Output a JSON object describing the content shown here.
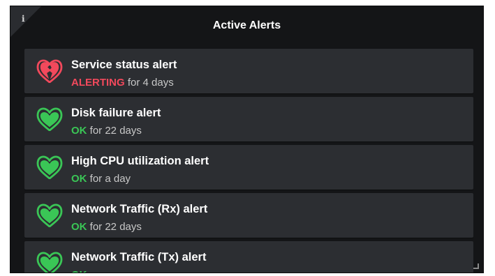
{
  "panel": {
    "title": "Active Alerts",
    "info_icon": "i"
  },
  "colors": {
    "alerting": "#f2495c",
    "ok": "#3ac656",
    "panel_bg": "#141517",
    "row_bg": "#2c2e32"
  },
  "alerts": [
    {
      "name": "Service status alert",
      "state": "ALERTING",
      "duration": "for 4 days",
      "icon": "broken-heart-icon"
    },
    {
      "name": "Disk failure alert",
      "state": "OK",
      "duration": "for 22 days",
      "icon": "heart-icon"
    },
    {
      "name": "High CPU utilization alert",
      "state": "OK",
      "duration": "for a day",
      "icon": "heart-icon"
    },
    {
      "name": "Network Traffic (Rx) alert",
      "state": "OK",
      "duration": "for 22 days",
      "icon": "heart-icon"
    },
    {
      "name": "Network Traffic (Tx) alert",
      "state": "OK",
      "duration": "",
      "icon": "heart-icon"
    }
  ]
}
